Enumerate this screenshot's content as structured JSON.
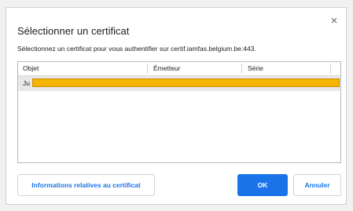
{
  "dialog": {
    "title": "Sélectionner un certificat",
    "subtitle": "Sélectionnez un certificat pour vous authentifier sur certif.iamfas.belgium.be:443.",
    "close_glyph": "×"
  },
  "table": {
    "columns": [
      "Objet",
      "Émetteur",
      "Série"
    ],
    "rows": [
      {
        "objet": "Ju",
        "redacted": true
      }
    ]
  },
  "buttons": {
    "info": "Informations relatives au certificat",
    "ok": "OK",
    "cancel": "Annuler"
  },
  "colors": {
    "accent": "#1a73e8",
    "selected_row": "#e8e8e8",
    "redaction": "#f4b400"
  },
  "icons": {
    "close": "close-icon"
  }
}
